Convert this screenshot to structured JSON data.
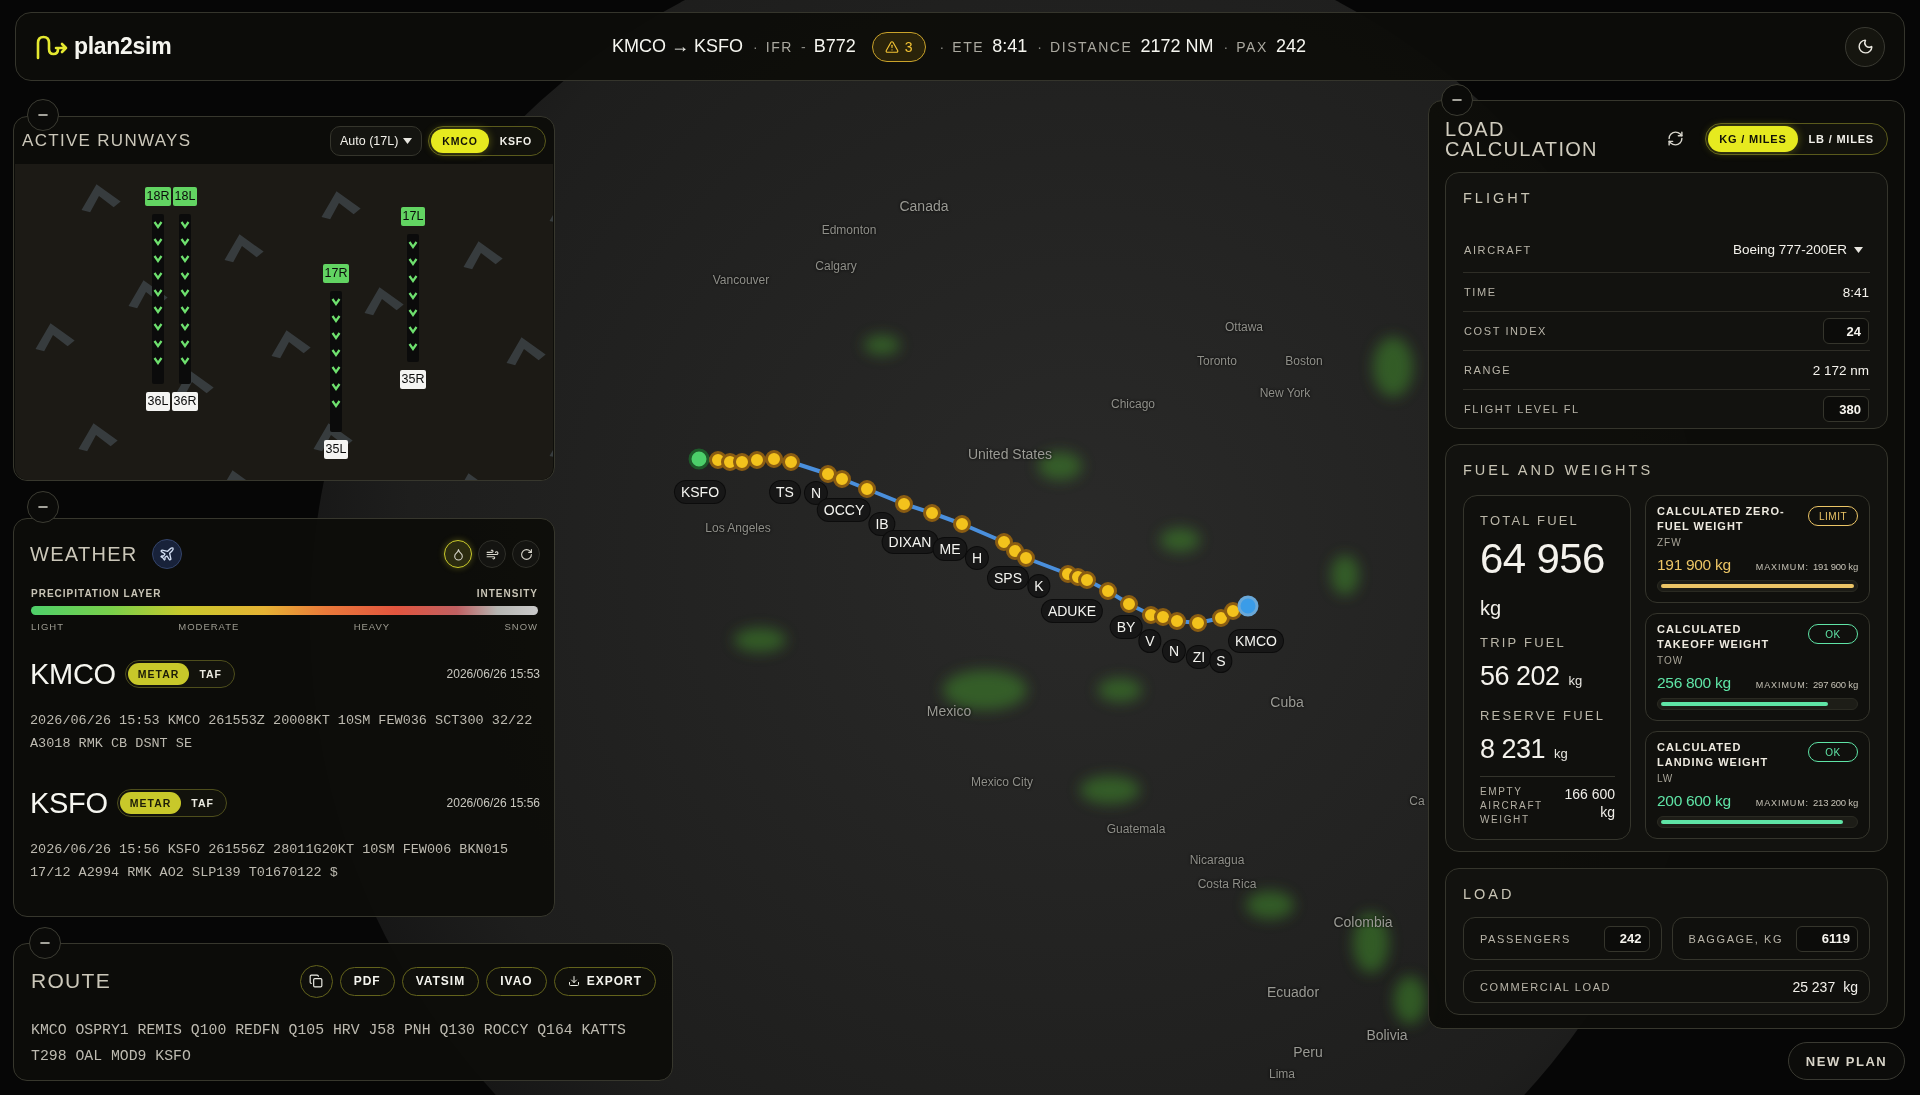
{
  "header": {
    "logo": "plan2sim",
    "items": [
      {
        "kind": "route",
        "text": "KMCO → KSFO"
      },
      {
        "kind": "sep",
        "text": "·"
      },
      {
        "kind": "label",
        "text": "IFR"
      },
      {
        "kind": "sep",
        "text": "-"
      },
      {
        "kind": "value",
        "text": "B772"
      },
      {
        "kind": "warning",
        "text": "3"
      },
      {
        "kind": "sep",
        "text": "·"
      },
      {
        "kind": "label",
        "text": "ETE"
      },
      {
        "kind": "value",
        "text": "8:41"
      },
      {
        "kind": "sep",
        "text": "·"
      },
      {
        "kind": "label",
        "text": "DISTANCE"
      },
      {
        "kind": "value",
        "text": "2172 NM"
      },
      {
        "kind": "sep",
        "text": "·"
      },
      {
        "kind": "label",
        "text": "PAX"
      },
      {
        "kind": "value",
        "text": "242"
      }
    ]
  },
  "map": {
    "places": [
      {
        "name": "Canada",
        "kind": "country"
      },
      {
        "name": "Edmonton",
        "kind": "city"
      },
      {
        "name": "Calgary",
        "kind": "city"
      },
      {
        "name": "Vancouver",
        "kind": "city"
      },
      {
        "name": "Ottawa",
        "kind": "city"
      },
      {
        "name": "Toronto",
        "kind": "city"
      },
      {
        "name": "Boston",
        "kind": "city"
      },
      {
        "name": "New York",
        "kind": "city"
      },
      {
        "name": "Chicago",
        "kind": "city"
      },
      {
        "name": "United States",
        "kind": "country"
      },
      {
        "name": "Los Angeles",
        "kind": "city"
      },
      {
        "name": "Cuba",
        "kind": "country"
      },
      {
        "name": "Mexico",
        "kind": "country"
      },
      {
        "name": "Mexico City",
        "kind": "city"
      },
      {
        "name": "Ca",
        "kind": "city"
      },
      {
        "name": "Guatemala",
        "kind": "city"
      },
      {
        "name": "Nicaragua",
        "kind": "city"
      },
      {
        "name": "Costa Rica",
        "kind": "city"
      },
      {
        "name": "Colombia",
        "kind": "country"
      },
      {
        "name": "Ecuador",
        "kind": "country"
      },
      {
        "name": "Bolivia",
        "kind": "country"
      },
      {
        "name": "Peru",
        "kind": "country"
      },
      {
        "name": "Lima",
        "kind": "city"
      }
    ],
    "waypoint_labels": [
      "KSFO",
      "TS",
      "N",
      "OCCY",
      "IB",
      "DIXAN",
      "ME",
      "H",
      "SPS",
      "K",
      "ADUKE",
      "BY",
      "V",
      "N",
      "ZI",
      "S",
      "KMCO"
    ]
  },
  "runways_panel": {
    "title": "ACTIVE RUNWAYS",
    "runway_select": "Auto (17L)",
    "airports": [
      {
        "label": "KMCO",
        "selected": true
      },
      {
        "label": "KSFO",
        "selected": false
      }
    ],
    "runways": [
      {
        "top": "18R",
        "bottom": "36L"
      },
      {
        "top": "18L",
        "bottom": "36R"
      },
      {
        "top": "17R",
        "bottom": "35L"
      },
      {
        "top": "17L",
        "bottom": "35R"
      }
    ]
  },
  "weather_panel": {
    "title": "WEATHER",
    "layers": [
      {
        "kind": "precipitation",
        "selected": true
      },
      {
        "kind": "wind",
        "selected": false
      }
    ],
    "legend": {
      "title": "PRECIPITATION LAYER",
      "scale_label": "INTENSITY",
      "ticks": [
        "LIGHT",
        "MODERATE",
        "HEAVY",
        "SNOW"
      ]
    },
    "stations": [
      {
        "code": "KMCO",
        "reports": [
          {
            "label": "METAR",
            "selected": true
          },
          {
            "label": "TAF",
            "selected": false
          }
        ],
        "time": "2026/06/26 15:53",
        "text": "2026/06/26 15:53 KMCO 261553Z 20008KT 10SM FEW036 SCT300 32/22 A3018 RMK CB DSNT SE"
      },
      {
        "code": "KSFO",
        "reports": [
          {
            "label": "METAR",
            "selected": true
          },
          {
            "label": "TAF",
            "selected": false
          }
        ],
        "time": "2026/06/26 15:56",
        "text": "2026/06/26 15:56 KSFO 261556Z 28011G20KT 10SM FEW006 BKN015 17/12 A2994 RMK AO2 SLP139 T01670122 $"
      }
    ]
  },
  "route_panel": {
    "title": "ROUTE",
    "buttons": [
      {
        "kind": "copy"
      },
      {
        "kind": "text",
        "label": "PDF"
      },
      {
        "kind": "text",
        "label": "VATSIM"
      },
      {
        "kind": "text",
        "label": "IVAO"
      },
      {
        "kind": "export",
        "label": "EXPORT"
      }
    ],
    "route": "KMCO OSPRY1 REMIS Q100 REDFN Q105 HRV J58 PNH Q130 ROCCY Q164 KATTS T298 OAL MOD9 KSFO"
  },
  "load_panel": {
    "title": "LOAD CALCULATION",
    "units": [
      {
        "label": "KG / MILES",
        "selected": true
      },
      {
        "label": "LB / MILES",
        "selected": false
      }
    ],
    "flight": {
      "title": "FLIGHT",
      "rows": [
        {
          "kind": "select",
          "label": "AIRCRAFT",
          "value": "Boeing 777-200ER"
        },
        {
          "kind": "text",
          "label": "TIME",
          "value": "8:41"
        },
        {
          "kind": "input",
          "label": "COST INDEX",
          "value": "24"
        },
        {
          "kind": "text",
          "label": "RANGE",
          "value": "2 172 nm"
        },
        {
          "kind": "input",
          "label": "FLIGHT LEVEL FL",
          "value": "380"
        }
      ]
    },
    "fuel": {
      "title": "FUEL AND WEIGHTS",
      "total": {
        "label": "TOTAL FUEL",
        "value": "64 956",
        "unit": "kg"
      },
      "trip": {
        "label": "TRIP FUEL",
        "value": "56 202",
        "unit": "kg"
      },
      "reserve": {
        "label": "RESERVE FUEL",
        "value": "8 231",
        "unit": "kg"
      },
      "empty_weight": {
        "label": "EMPTY AIRCRAFT WEIGHT",
        "value": "166 600",
        "unit": "kg"
      },
      "weights": [
        {
          "title": "CALCULATED ZERO-FUEL WEIGHT",
          "abbr": "ZFW",
          "kind": "limit",
          "badge": "LIMIT",
          "value": "191 900 kg",
          "max_label": "MAXIMUM:",
          "max": "191 900 kg",
          "level": 1.0
        },
        {
          "title": "CALCULATED TAKEOFF WEIGHT",
          "abbr": "TOW",
          "kind": "ok",
          "badge": "OK",
          "value": "256 800 kg",
          "max_label": "MAXIMUM:",
          "max": "297 600 kg",
          "level": 0.863
        },
        {
          "title": "CALCULATED LANDING WEIGHT",
          "abbr": "LW",
          "kind": "ok",
          "badge": "OK",
          "value": "200 600 kg",
          "max_label": "MAXIMUM:",
          "max": "213 200 kg",
          "level": 0.941
        }
      ]
    },
    "load": {
      "title": "LOAD",
      "fields": [
        {
          "label": "PASSENGERS",
          "value": "242"
        },
        {
          "label": "BAGGAGE, KG",
          "value": "6119"
        }
      ],
      "commercial": {
        "label": "COMMERCIAL LOAD",
        "value": "25 237",
        "unit": "kg"
      }
    }
  },
  "new_plan_button": "NEW PLAN"
}
